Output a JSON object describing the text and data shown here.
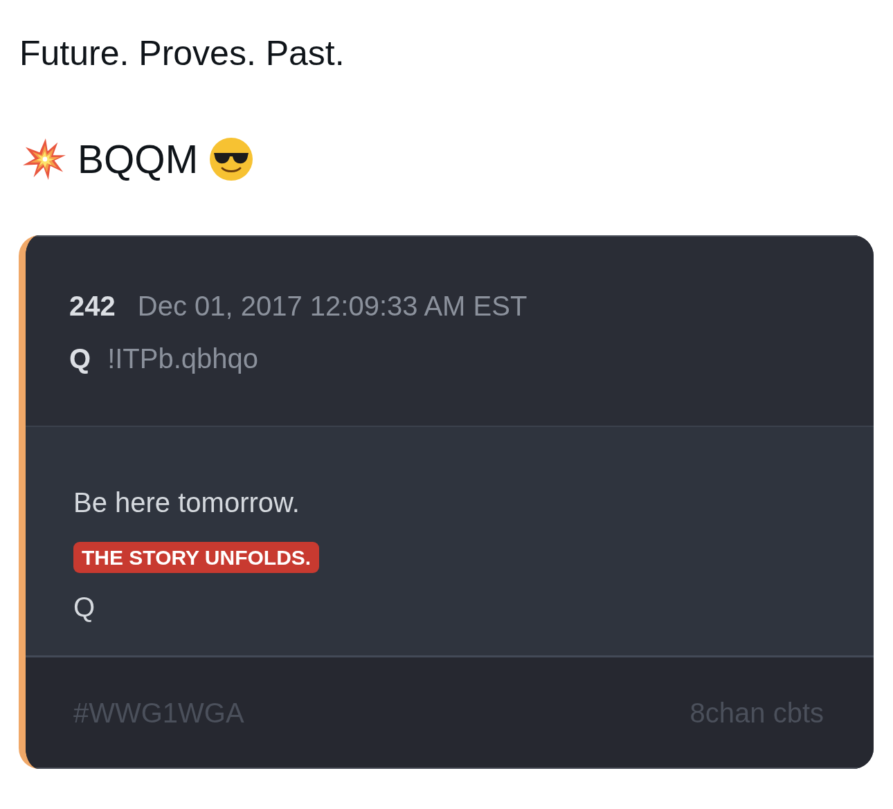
{
  "post": {
    "line_1": "Future. Proves. Past.",
    "line_2": "BQQM"
  },
  "quote_card": {
    "post_number": "242",
    "timestamp": "Dec 01, 2017 12:09:33 AM EST",
    "author": "Q",
    "tripcode": "!ITPb.qbhqo",
    "body": [
      {
        "kind": "text",
        "text": "Be here tomorrow."
      },
      {
        "kind": "highlight",
        "text": "THE STORY UNFOLDS."
      },
      {
        "kind": "text",
        "text": "Q"
      }
    ],
    "hashtag": "#WWG1WGA",
    "source": "8chan cbts"
  }
}
